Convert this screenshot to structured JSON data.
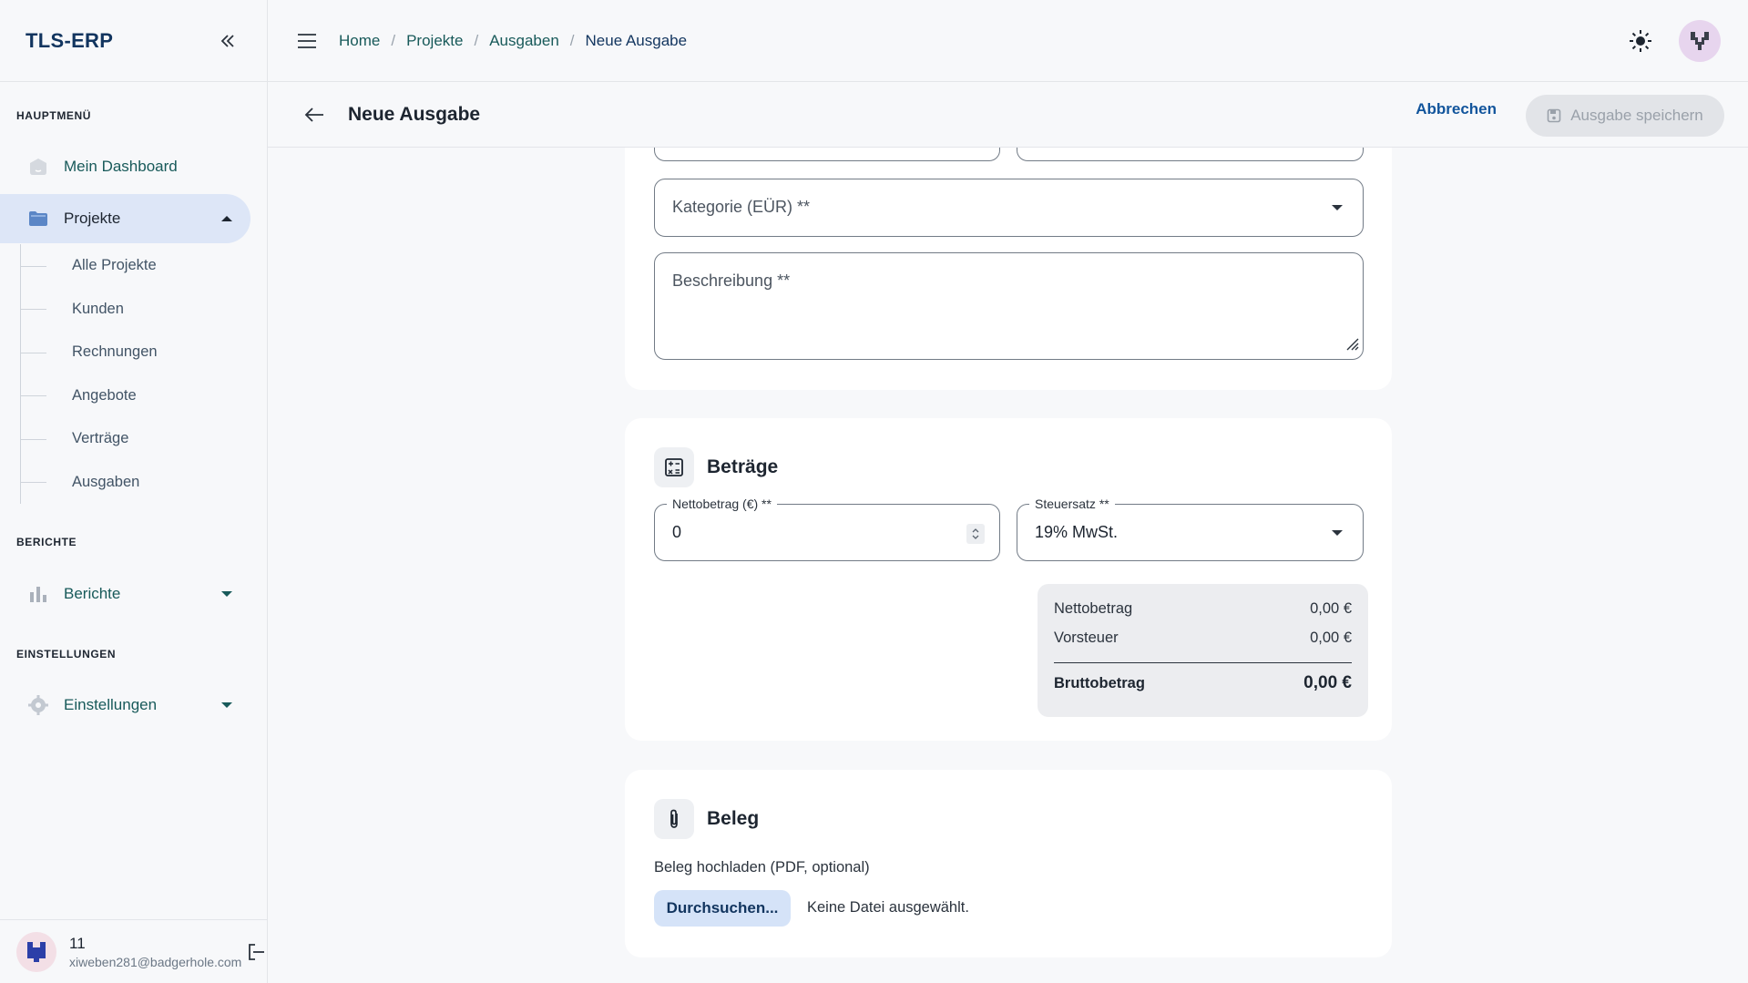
{
  "app": {
    "brand": "TLS-ERP"
  },
  "sidebar": {
    "sections": {
      "main": "HAUPTMENÜ",
      "reports": "BERICHTE",
      "settings": "EINSTELLUNGEN"
    },
    "items": {
      "dashboard": "Mein Dashboard",
      "projects": "Projekte",
      "reports": "Berichte",
      "settings": "Einstellungen"
    },
    "subitems": [
      "Alle Projekte",
      "Kunden",
      "Rechnungen",
      "Angebote",
      "Verträge",
      "Ausgaben"
    ]
  },
  "user": {
    "name": "11",
    "email": "xiweben281@badgerhole.com"
  },
  "breadcrumb": [
    "Home",
    "Projekte",
    "Ausgaben",
    "Neue Ausgabe"
  ],
  "breadcrumb_sep": "/",
  "header": {
    "title": "Neue Ausgabe",
    "cancel_label": "Abbrechen",
    "save_label": "Ausgabe speichern"
  },
  "form": {
    "category_placeholder": "Kategorie (EÜR) **",
    "description_placeholder": "Beschreibung **"
  },
  "amounts": {
    "title": "Beträge",
    "net_label": "Nettobetrag (€) **",
    "net_value": "0",
    "tax_label": "Steuersatz **",
    "tax_value": "19% MwSt.",
    "summary": {
      "net_label": "Nettobetrag",
      "net_value": "0,00 €",
      "vat_label": "Vorsteuer",
      "vat_value": "0,00 €",
      "gross_label": "Bruttobetrag",
      "gross_value": "0,00 €"
    }
  },
  "receipt": {
    "title": "Beleg",
    "upload_label": "Beleg hochladen (PDF, optional)",
    "browse_label": "Durchsuchen...",
    "no_file": "Keine Datei ausgewählt."
  },
  "colors": {
    "brand": "#12355f",
    "link": "#185a5a",
    "active_nav_bg": "#dde6f7",
    "accent_button": "#d5e3f8"
  }
}
